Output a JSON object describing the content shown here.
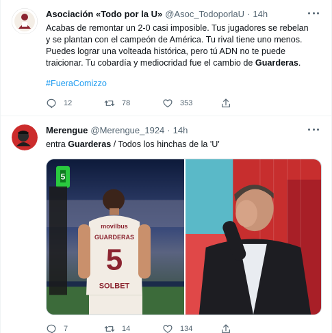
{
  "tweets": [
    {
      "name": "Asociación «Todo por la U»",
      "handle": "@Asoc_TodoporlaU",
      "time": "14h",
      "text_before": "Acabas de remontar un 2-0 casi imposible. Tus jugadores se rebelan y se plantan con el campeón de América. Tu rival tiene uno menos. Puedes lograr una volteada histórica, pero tú ADN no te puede traicionar. Tu cobardía y mediocridad fue el cambio de ",
      "text_bold": "Guarderas",
      "text_after": ".",
      "hashtag": "#FueraComizzo",
      "replies": "12",
      "retweets": "78",
      "likes": "353"
    },
    {
      "name": "Merengue",
      "handle": "@Merengue_1924",
      "time": "14h",
      "text_before": "entra ",
      "text_bold": "Guarderas",
      "text_after": " / Todos los hinchas de la 'U'",
      "media": {
        "jersey_sponsor": "movilbus",
        "jersey_name": "GUARDERAS",
        "jersey_number": "5",
        "jersey_sponsor_bottom": "SOLBET",
        "board_number": "5"
      },
      "replies": "7",
      "retweets": "14",
      "likes": "134"
    }
  ],
  "colors": {
    "accent": "#1d9bf0",
    "secondary_text": "#536471",
    "primary_text": "#0f1419"
  },
  "icons": [
    "reply-icon",
    "retweet-icon",
    "like-icon",
    "share-icon",
    "more-icon"
  ]
}
